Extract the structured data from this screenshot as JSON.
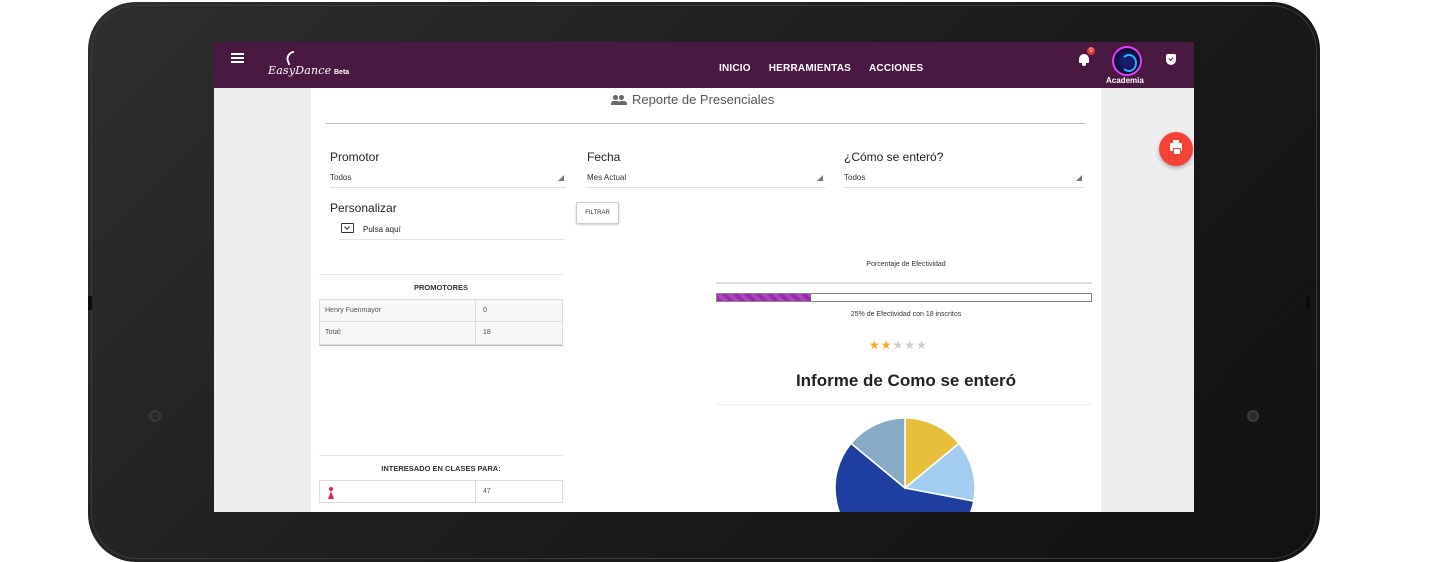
{
  "navbar": {
    "brand": "EasyDance",
    "beta": "Beta",
    "menu": [
      "INICIO",
      "HERRAMIENTAS",
      "ACCIONES"
    ],
    "notification_count": "0",
    "account_label": "Academia",
    "color": "#4a1942"
  },
  "page": {
    "title": "Reporte de Presenciales"
  },
  "filters": {
    "promotor": {
      "label": "Promotor",
      "value": "Todos"
    },
    "fecha": {
      "label": "Fecha",
      "value": "Mes Actual"
    },
    "como": {
      "label": "¿Cómo se enteró?",
      "value": "Todos"
    },
    "personalizar": {
      "label": "Personalizar",
      "action": "Pulsa aquí"
    },
    "filter_button": "FILTRAR"
  },
  "promotores": {
    "header": "PROMOTORES",
    "rows": [
      {
        "name": "Henry Fuenmayor",
        "value": "0"
      },
      {
        "name": "Total:",
        "value": "18"
      }
    ]
  },
  "interesado": {
    "header": "INTERESADO EN CLASES PARA:",
    "rows": [
      {
        "icon": "female-icon",
        "value": "47"
      }
    ]
  },
  "efectividad": {
    "title": "Porcentaje de Efectividad",
    "percent": 25,
    "caption": "25% de Efectividad con 18 inscritos",
    "stars_filled": 2,
    "stars_total": 5
  },
  "informe": {
    "title": "Informe de Como se enteró"
  },
  "chart_data": {
    "type": "pie",
    "values": [
      14,
      14,
      58,
      14
    ],
    "colors": [
      "#e8bf3c",
      "#a3cdf0",
      "#1f3fa0",
      "#89aac4"
    ],
    "labels": []
  },
  "icons": {
    "menu": "hamburger-icon",
    "notifications": "bell-icon",
    "security": "shield-icon",
    "print": "print-icon",
    "title": "people-icon",
    "custom": "calendar-download-icon"
  }
}
